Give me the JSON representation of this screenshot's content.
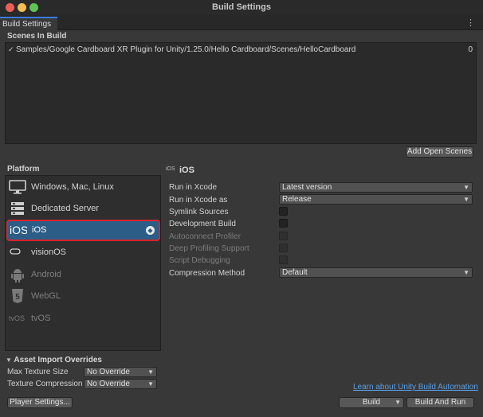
{
  "window": {
    "title": "Build Settings",
    "tab_label": "Build Settings",
    "tab_menu_icon": "kebab-menu-icon"
  },
  "scenes": {
    "header": "Scenes In Build",
    "items": [
      {
        "checked": true,
        "path": "Samples/Google Cardboard XR Plugin for Unity/1.25.0/Hello Cardboard/Scenes/HelloCardboard",
        "index": "0"
      }
    ],
    "add_open_scenes_label": "Add Open Scenes"
  },
  "platform": {
    "header": "Platform",
    "items": [
      {
        "label": "Windows, Mac, Linux",
        "icon": "monitor-icon",
        "enabled": true,
        "selected": false
      },
      {
        "label": "Dedicated Server",
        "icon": "server-icon",
        "enabled": true,
        "selected": false
      },
      {
        "label": "iOS",
        "icon": "ios-icon",
        "enabled": true,
        "selected": true,
        "active_badge": "unity-logo-icon"
      },
      {
        "label": "visionOS",
        "icon": "vision-pro-icon",
        "enabled": true,
        "selected": false
      },
      {
        "label": "Android",
        "icon": "android-icon",
        "enabled": false,
        "selected": false
      },
      {
        "label": "WebGL",
        "icon": "html5-icon",
        "enabled": false,
        "selected": false
      },
      {
        "label": "tvOS",
        "icon": "tvos-icon",
        "enabled": false,
        "selected": false
      }
    ]
  },
  "settings": {
    "title": "iOS",
    "title_icon_text": "iOS",
    "run_in_xcode": {
      "label": "Run in Xcode",
      "value": "Latest version"
    },
    "run_in_xcode_as": {
      "label": "Run in Xcode as",
      "value": "Release"
    },
    "symlink_sources": {
      "label": "Symlink Sources",
      "checked": false,
      "enabled": true
    },
    "development_build": {
      "label": "Development Build",
      "checked": false,
      "enabled": true
    },
    "autoconnect_profiler": {
      "label": "Autoconnect Profiler",
      "checked": false,
      "enabled": false
    },
    "deep_profiling_support": {
      "label": "Deep Profiling Support",
      "checked": false,
      "enabled": false
    },
    "script_debugging": {
      "label": "Script Debugging",
      "checked": false,
      "enabled": false
    },
    "compression_method": {
      "label": "Compression Method",
      "value": "Default"
    }
  },
  "asset_import_overrides": {
    "header": "Asset Import Overrides",
    "max_texture_size": {
      "label": "Max Texture Size",
      "value": "No Override"
    },
    "texture_compression": {
      "label": "Texture Compression",
      "value": "No Override"
    }
  },
  "footer": {
    "player_settings_label": "Player Settings...",
    "learn_link": "Learn about Unity Build Automation",
    "build_label": "Build",
    "build_and_run_label": "Build And Run"
  },
  "colors": {
    "selection": "#2c5d87",
    "highlight_outline": "#d8232a",
    "link": "#5a9fe6",
    "tab_accent": "#3a7be0"
  }
}
